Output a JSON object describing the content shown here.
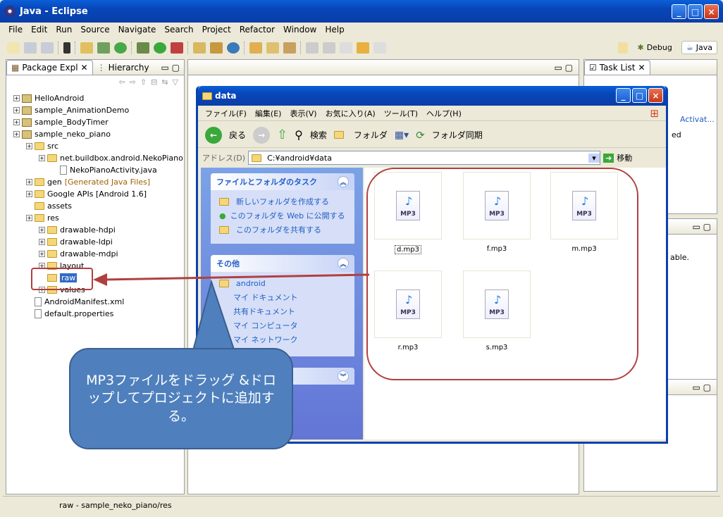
{
  "eclipse": {
    "title": "Java - Eclipse",
    "menu": [
      "File",
      "Edit",
      "Run",
      "Source",
      "Navigate",
      "Search",
      "Project",
      "Refactor",
      "Window",
      "Help"
    ],
    "perspectives": {
      "debug": "Debug",
      "java": "Java"
    },
    "tabs": {
      "package": "Package Expl",
      "hierarchy": "Hierarchy",
      "tasklist": "Task List"
    },
    "side_text": {
      "activat": "Activat...",
      "ed": "ed",
      "able": "able."
    },
    "status": "raw - sample_neko_piano/res"
  },
  "tree": [
    {
      "label": "HelloAndroid",
      "indent": 0,
      "icon": "project"
    },
    {
      "label": "sample_AnimationDemo",
      "indent": 0,
      "icon": "project"
    },
    {
      "label": "sample_BodyTimer",
      "indent": 0,
      "icon": "project"
    },
    {
      "label": "sample_neko_piano",
      "indent": 0,
      "icon": "project"
    },
    {
      "label": "src",
      "indent": 1,
      "icon": "folder"
    },
    {
      "label": "net.buildbox.android.NekoPiano",
      "indent": 2,
      "icon": "package"
    },
    {
      "label": "NekoPianoActivity.java",
      "indent": 3,
      "icon": "file"
    },
    {
      "label": "gen",
      "suffix": "[Generated Java Files]",
      "indent": 1,
      "icon": "folder"
    },
    {
      "label": "Google APIs [Android 1.6]",
      "indent": 1,
      "icon": "library"
    },
    {
      "label": "assets",
      "indent": 1,
      "icon": "folder"
    },
    {
      "label": "res",
      "indent": 1,
      "icon": "folder"
    },
    {
      "label": "drawable-hdpi",
      "indent": 2,
      "icon": "folder"
    },
    {
      "label": "drawable-ldpi",
      "indent": 2,
      "icon": "folder"
    },
    {
      "label": "drawable-mdpi",
      "indent": 2,
      "icon": "folder"
    },
    {
      "label": "layout",
      "indent": 2,
      "icon": "folder"
    },
    {
      "label": "raw",
      "indent": 2,
      "icon": "folder",
      "selected": true
    },
    {
      "label": "values",
      "indent": 2,
      "icon": "folder"
    },
    {
      "label": "AndroidManifest.xml",
      "indent": 1,
      "icon": "file"
    },
    {
      "label": "default.properties",
      "indent": 1,
      "icon": "file"
    }
  ],
  "explorer": {
    "title": "data",
    "menu": [
      "ファイル(F)",
      "編集(E)",
      "表示(V)",
      "お気に入り(A)",
      "ツール(T)",
      "ヘルプ(H)"
    ],
    "tools": {
      "back": "戻る",
      "search": "検索",
      "folder": "フォルダ",
      "sync": "フォルダ同期"
    },
    "address_label": "アドレス(D)",
    "address": "C:¥android¥data",
    "go": "移動",
    "tasks_title": "ファイルとフォルダのタスク",
    "tasks": [
      "新しいフォルダを作成する",
      "このフォルダを Web に公開する",
      "このフォルダを共有する"
    ],
    "other_title": "その他",
    "other": [
      "android",
      "マイ ドキュメント",
      "共有ドキュメント",
      "マイ コンピュータ",
      "マイ ネットワーク"
    ],
    "files": [
      "d.mp3",
      "f.mp3",
      "m.mp3",
      "r.mp3",
      "s.mp3"
    ],
    "file_badge": "MP3"
  },
  "callout": "MP3ファイルをドラッグ &ドロップしてプロジェクトに追加する。",
  "colors": {
    "accent": "#b04040",
    "callout": "#4f80bd",
    "xp_title": "#0846b8"
  }
}
